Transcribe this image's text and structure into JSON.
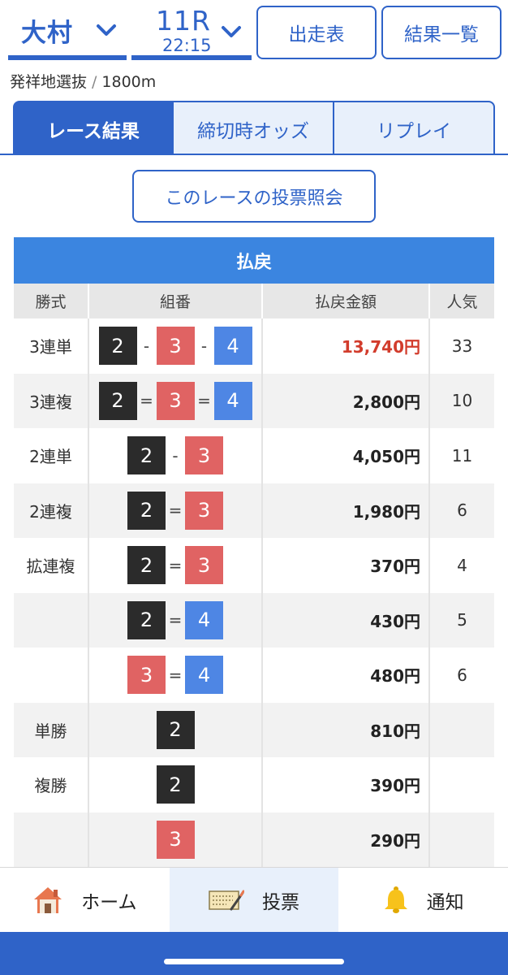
{
  "header": {
    "venue": "大村",
    "race_number": "11R",
    "race_time": "22:15",
    "entries_button": "出走表",
    "results_button": "結果一覧"
  },
  "race_info": {
    "name": "発祥地選抜",
    "separator": "/",
    "distance": "1800m"
  },
  "tabs": [
    {
      "label": "レース結果",
      "active": true
    },
    {
      "label": "締切時オッズ",
      "active": false
    },
    {
      "label": "リプレイ",
      "active": false
    }
  ],
  "inquiry_button": "このレースの投票照会",
  "payout": {
    "title": "払戻",
    "columns": [
      "勝式",
      "組番",
      "払戻金額",
      "人気"
    ],
    "boat_colors": {
      "2": "#2b2b2b",
      "3": "#e06363",
      "4": "#4e86e4"
    },
    "rows": [
      {
        "bet_type": "3連単",
        "combo": [
          "2",
          "-",
          "3",
          "-",
          "4"
        ],
        "amount": "13,740円",
        "highlight": true,
        "popularity": "33"
      },
      {
        "bet_type": "3連複",
        "combo": [
          "2",
          "=",
          "3",
          "=",
          "4"
        ],
        "amount": "2,800円",
        "popularity": "10"
      },
      {
        "bet_type": "2連単",
        "combo": [
          "2",
          "-",
          "3"
        ],
        "amount": "4,050円",
        "popularity": "11"
      },
      {
        "bet_type": "2連複",
        "combo": [
          "2",
          "=",
          "3"
        ],
        "amount": "1,980円",
        "popularity": "6"
      },
      {
        "bet_type": "拡連複",
        "combo": [
          "2",
          "=",
          "3"
        ],
        "amount": "370円",
        "popularity": "4"
      },
      {
        "bet_type": "",
        "combo": [
          "2",
          "=",
          "4"
        ],
        "amount": "430円",
        "popularity": "5"
      },
      {
        "bet_type": "",
        "combo": [
          "3",
          "=",
          "4"
        ],
        "amount": "480円",
        "popularity": "6"
      },
      {
        "bet_type": "単勝",
        "combo": [
          "2"
        ],
        "amount": "810円",
        "popularity": ""
      },
      {
        "bet_type": "複勝",
        "combo": [
          "2"
        ],
        "amount": "390円",
        "popularity": ""
      },
      {
        "bet_type": "",
        "combo": [
          "3"
        ],
        "amount": "290円",
        "popularity": ""
      }
    ]
  },
  "bottom_nav": [
    {
      "label": "ホーム",
      "icon": "house-icon",
      "active": false
    },
    {
      "label": "投票",
      "icon": "ticket-icon",
      "active": true
    },
    {
      "label": "通知",
      "icon": "bell-icon",
      "active": false
    }
  ]
}
